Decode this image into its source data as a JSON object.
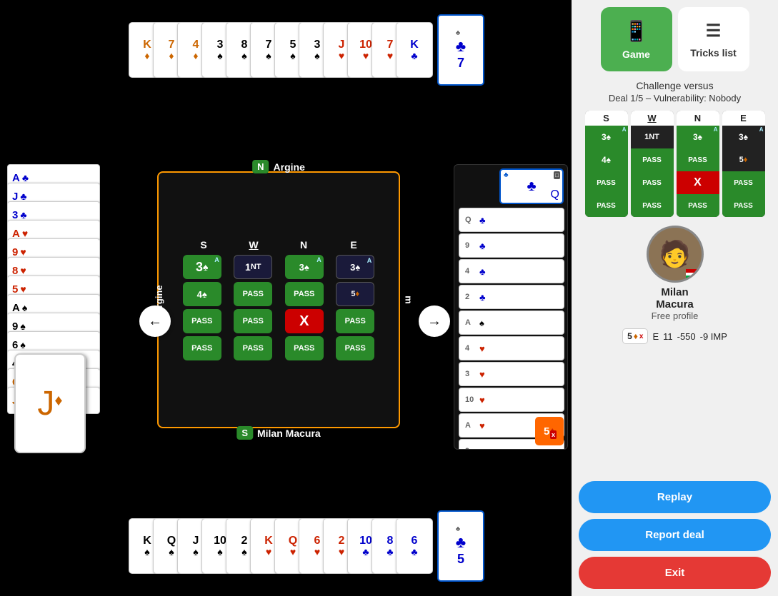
{
  "tabs": {
    "game": {
      "label": "Game",
      "icon": "📱",
      "active": true
    },
    "tricks_list": {
      "label": "Tricks list",
      "icon": "≡",
      "active": false
    }
  },
  "challenge": {
    "title": "Challenge versus",
    "deal_info": "Deal 1/5 – Vulnerability: Nobody"
  },
  "directions": {
    "s": "S",
    "w": "W",
    "n": "N",
    "e": "E"
  },
  "north_player": "Argine",
  "south_player": "Milan Macura",
  "west_label": "Argine",
  "east_label": "Argine",
  "nav_left": "←",
  "nav_right": "→",
  "profile": {
    "name": "Milan",
    "surname": "Macura",
    "sub": "Free profile"
  },
  "score": {
    "contract": "5♦",
    "doubled": "x",
    "direction": "E",
    "tricks": "11",
    "score": "-550",
    "imp": "-9 IMP"
  },
  "buttons": {
    "replay": "Replay",
    "report": "Report deal",
    "exit": "Exit"
  },
  "top_hand": [
    {
      "rank": "K",
      "suit": "♦",
      "color": "orange"
    },
    {
      "rank": "7",
      "suit": "♦",
      "color": "orange"
    },
    {
      "rank": "4",
      "suit": "♦",
      "color": "orange"
    },
    {
      "rank": "3",
      "suit": "♠",
      "color": "black"
    },
    {
      "rank": "8",
      "suit": "♠",
      "color": "black"
    },
    {
      "rank": "7",
      "suit": "♠",
      "color": "black"
    },
    {
      "rank": "5",
      "suit": "♠",
      "color": "black"
    },
    {
      "rank": "3",
      "suit": "♠",
      "color": "black"
    },
    {
      "rank": "J",
      "suit": "♥",
      "color": "red"
    },
    {
      "rank": "10",
      "suit": "♥",
      "color": "red"
    },
    {
      "rank": "7",
      "suit": "♥",
      "color": "red"
    },
    {
      "rank": "K",
      "suit": "♣",
      "color": "blue"
    },
    {
      "rank": "7",
      "suit": "♣",
      "color": "blue"
    }
  ],
  "bottom_hand": [
    {
      "rank": "K",
      "suit": "♠",
      "color": "black"
    },
    {
      "rank": "Q",
      "suit": "♠",
      "color": "black"
    },
    {
      "rank": "J",
      "suit": "♠",
      "color": "black"
    },
    {
      "rank": "10",
      "suit": "♠",
      "color": "black"
    },
    {
      "rank": "2",
      "suit": "♠",
      "color": "black"
    },
    {
      "rank": "K",
      "suit": "♥",
      "color": "red"
    },
    {
      "rank": "Q",
      "suit": "♥",
      "color": "red"
    },
    {
      "rank": "6",
      "suit": "♥",
      "color": "red"
    },
    {
      "rank": "2",
      "suit": "♥",
      "color": "red"
    },
    {
      "rank": "10",
      "suit": "♣",
      "color": "blue"
    },
    {
      "rank": "8",
      "suit": "♣",
      "color": "blue"
    },
    {
      "rank": "6",
      "suit": "♣",
      "color": "blue"
    },
    {
      "rank": "5",
      "suit": "♣",
      "color": "blue"
    }
  ],
  "left_hand": [
    {
      "rank": "A",
      "suit": "♣",
      "color": "blue"
    },
    {
      "rank": "J",
      "suit": "♣",
      "color": "blue"
    },
    {
      "rank": "3",
      "suit": "♣",
      "color": "blue"
    },
    {
      "rank": "A",
      "suit": "♥",
      "color": "red"
    },
    {
      "rank": "9",
      "suit": "♥",
      "color": "red"
    },
    {
      "rank": "8",
      "suit": "♥",
      "color": "red"
    },
    {
      "rank": "5",
      "suit": "♥",
      "color": "red"
    },
    {
      "rank": "A",
      "suit": "♠",
      "color": "black"
    },
    {
      "rank": "9",
      "suit": "♠",
      "color": "black"
    },
    {
      "rank": "6",
      "suit": "♠",
      "color": "black"
    },
    {
      "rank": "4",
      "suit": "♠",
      "color": "black"
    },
    {
      "rank": "Q",
      "suit": "♦",
      "color": "orange"
    },
    {
      "rank": "J",
      "suit": "♦",
      "color": "orange"
    }
  ],
  "bidding": {
    "s_bids": [
      {
        "label": "3",
        "suit": "♠",
        "color": "green",
        "badge": "A"
      },
      {
        "label": "4♠",
        "color": "green"
      },
      {
        "label": "PASS",
        "color": "green"
      },
      {
        "label": "PASS",
        "color": "green"
      }
    ],
    "w_bids": [
      {
        "label": "1NT",
        "color": "dark"
      },
      {
        "label": "PASS",
        "color": "green"
      },
      {
        "label": "PASS",
        "color": "green"
      },
      {
        "label": "PASS",
        "color": "green"
      }
    ],
    "n_bids": [
      {
        "label": "3♠",
        "color": "green",
        "badge": "A"
      },
      {
        "label": "PASS",
        "color": "green"
      },
      {
        "label": "X",
        "color": "red"
      },
      {
        "label": "PASS",
        "color": "green"
      }
    ],
    "e_bids": [
      {
        "label": "3",
        "suit": "♠",
        "color": "dark",
        "badge": "A"
      },
      {
        "label": "5♦",
        "color": "dark",
        "suit_color": "orange"
      },
      {
        "label": "PASS",
        "color": "green"
      },
      {
        "label": "PASS",
        "color": "green"
      }
    ]
  },
  "summary_bids": {
    "s": [
      {
        "label": "3▲",
        "color": "green",
        "badge": "A"
      },
      {
        "label": "4♠",
        "color": "green"
      },
      {
        "label": "PASS",
        "color": "green"
      },
      {
        "label": "PASS",
        "color": "green"
      }
    ],
    "w": [
      {
        "label": "1NT",
        "color": "dark"
      },
      {
        "label": "PASS",
        "color": "green"
      },
      {
        "label": "PASS",
        "color": "green"
      },
      {
        "label": "PASS",
        "color": "green"
      }
    ],
    "n": [
      {
        "label": "3♠",
        "color": "green",
        "badge": "A"
      },
      {
        "label": "PASS",
        "color": "green"
      },
      {
        "label": "X",
        "color": "red"
      },
      {
        "label": "PASS",
        "color": "green"
      }
    ],
    "e": [
      {
        "label": "3▲",
        "color": "dark",
        "badge": "A"
      },
      {
        "label": "5♦",
        "color": "dark"
      },
      {
        "label": "PASS",
        "color": "green"
      },
      {
        "label": "PASS",
        "color": "green"
      }
    ]
  }
}
